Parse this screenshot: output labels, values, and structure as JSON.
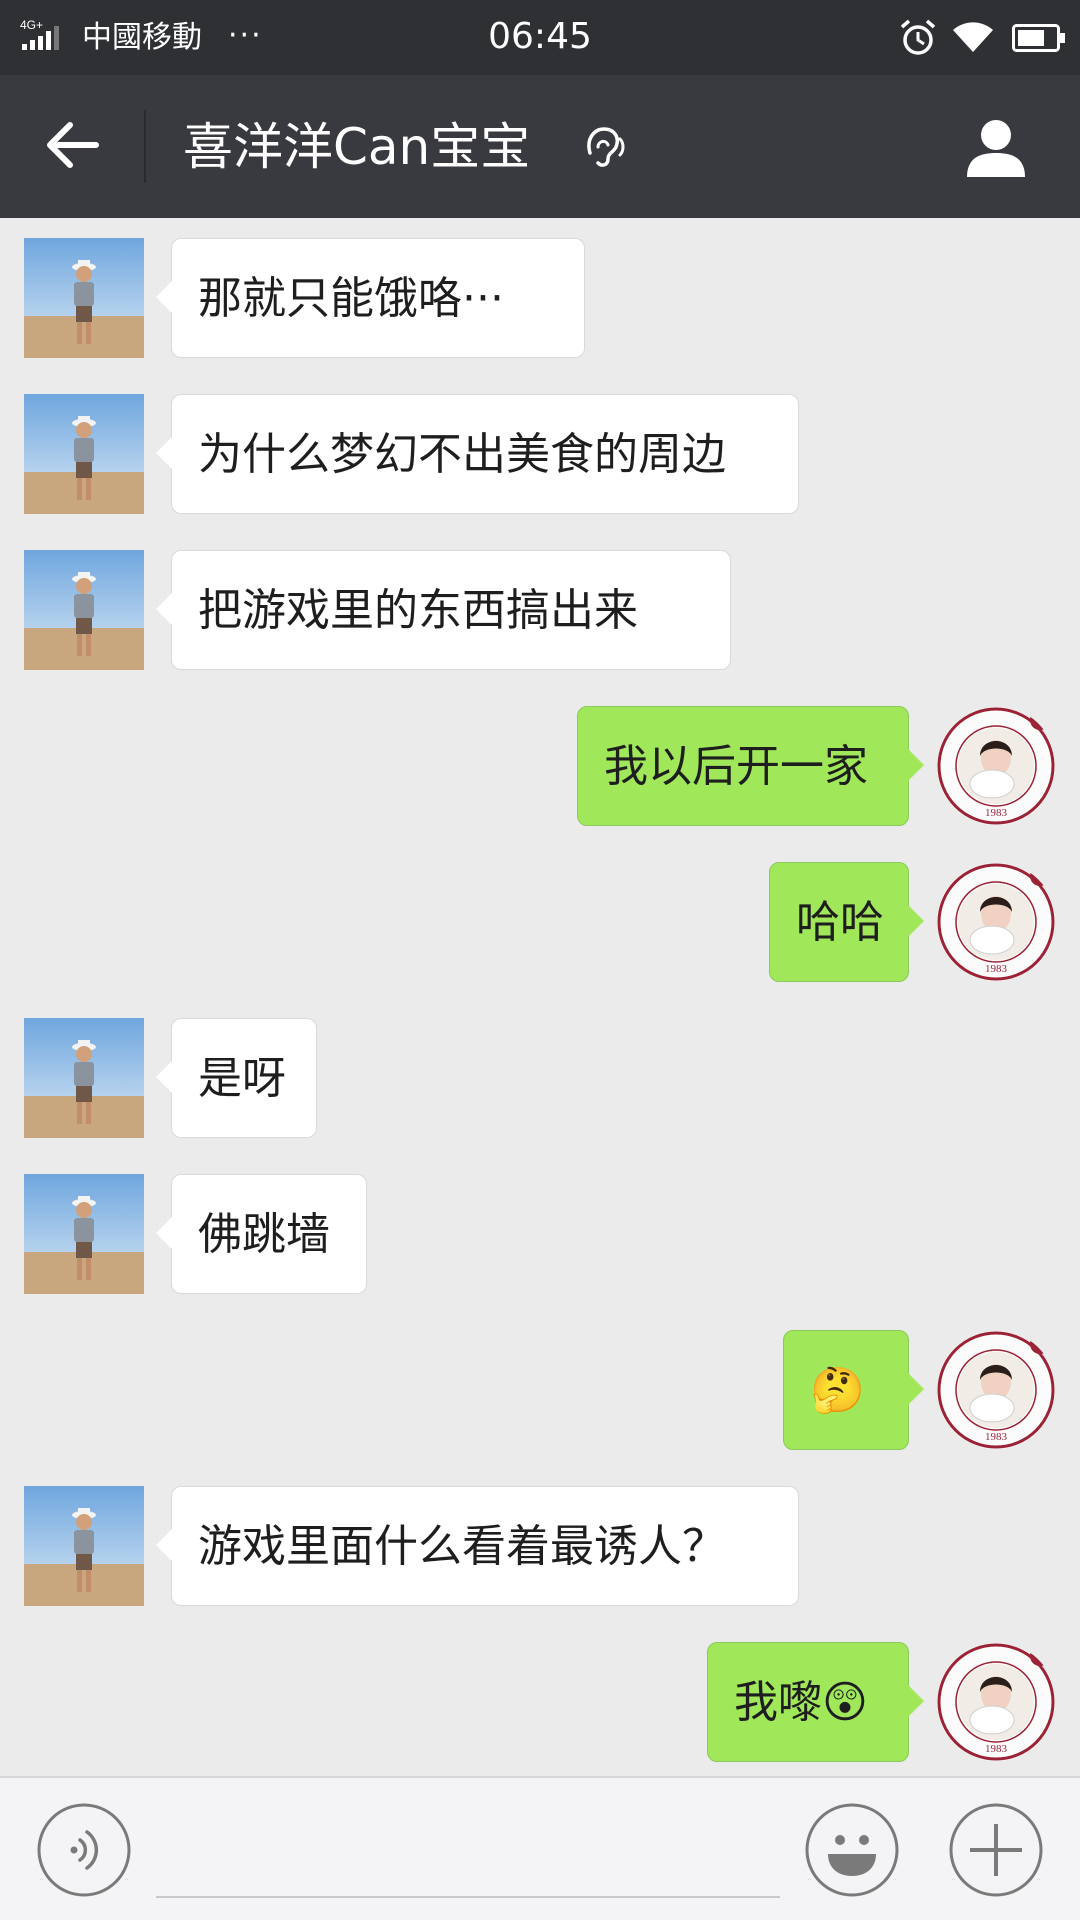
{
  "status_bar": {
    "network": "4G+",
    "carrier": "中國移動",
    "more": "···",
    "time": "06:45"
  },
  "title_bar": {
    "title": "喜洋洋Can宝宝"
  },
  "messages": [
    {
      "side": "left",
      "text": "那就只能饿咯···"
    },
    {
      "side": "left",
      "text": "为什么梦幻不出美食的周边"
    },
    {
      "side": "left",
      "text": "把游戏里的东西搞出来"
    },
    {
      "side": "right",
      "text": "我以后开一家"
    },
    {
      "side": "right",
      "text": "哈哈"
    },
    {
      "side": "left",
      "text": "是呀"
    },
    {
      "side": "left",
      "text": "佛跳墙"
    },
    {
      "side": "right",
      "text": "🤔"
    },
    {
      "side": "left",
      "text": "游戏里面什么看着最诱人？"
    },
    {
      "side": "right",
      "text": "我嚟😲"
    }
  ],
  "colors": {
    "status_bg": "#2e3033",
    "title_bg": "#393a3f",
    "chat_bg": "#ebebeb",
    "sent_bubble": "#a0e75a",
    "received_bubble": "#ffffff"
  },
  "icons": {
    "back": "arrow-left-icon",
    "earpiece": "ear-icon",
    "profile": "person-icon",
    "voice": "voice-icon",
    "emoji": "smiley-icon",
    "plus": "plus-icon"
  }
}
